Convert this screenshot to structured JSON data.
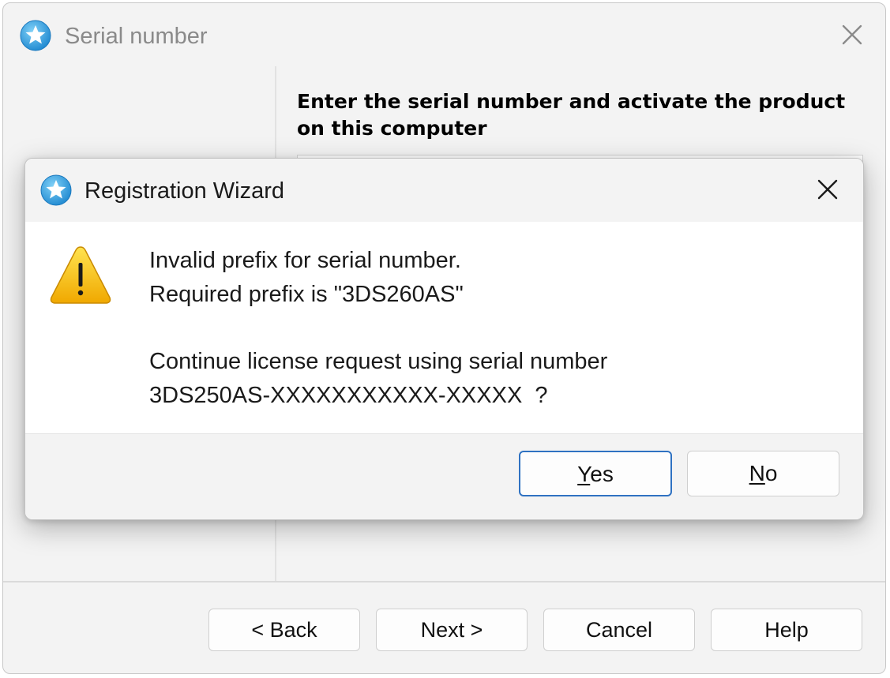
{
  "outer_window": {
    "title": "Serial number",
    "icon": "star-badge-icon",
    "heading": "Enter the serial number and activate the product on this computer",
    "buttons": {
      "back": "< Back",
      "next": "Next >",
      "cancel": "Cancel",
      "help": "Help"
    }
  },
  "dialog": {
    "title": "Registration Wizard",
    "icon": "star-badge-icon",
    "warning_icon": "warning-triangle-icon",
    "message": {
      "line1": "Invalid prefix for serial number.",
      "line2": "Required prefix is \"3DS260AS\"",
      "line3": "Continue license request using serial number",
      "line4": "3DS250AS-XXXXXXXXXXX-XXXXX  ?"
    },
    "buttons": {
      "yes_accel": "Y",
      "yes_rest": "es",
      "no_accel": "N",
      "no_rest": "o"
    }
  },
  "colors": {
    "accent": "#2f72c2",
    "icon_blue": "#3aa3e3",
    "warning_yellow": "#f4c21b",
    "chrome_bg": "#f3f3f3"
  }
}
